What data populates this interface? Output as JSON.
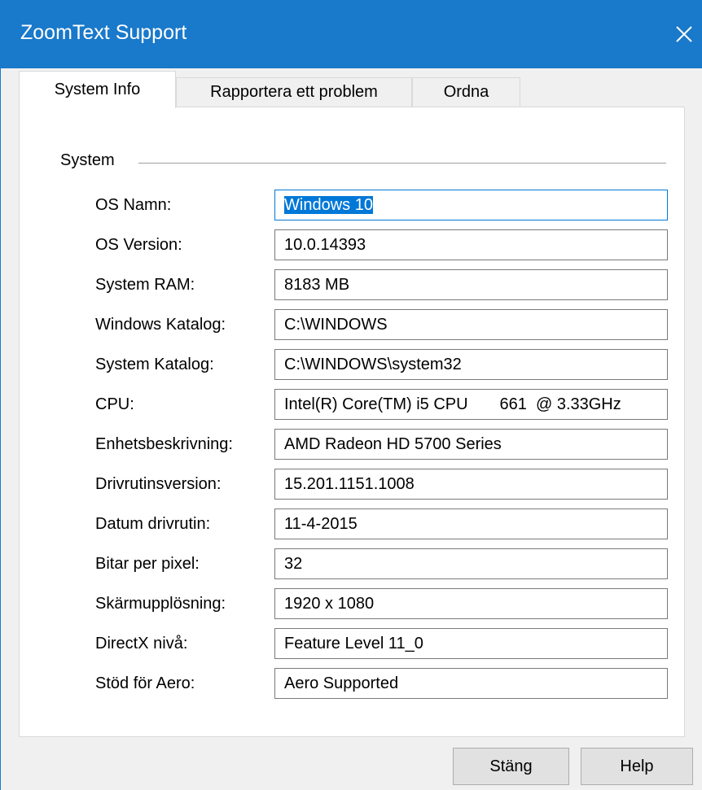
{
  "window": {
    "title": "ZoomText Support",
    "close_label": "×"
  },
  "tabs": [
    {
      "label": "System Info",
      "active": true
    },
    {
      "label": "Rapportera ett problem",
      "active": false
    },
    {
      "label": "Ordna",
      "active": false
    }
  ],
  "system_group": {
    "label": "System",
    "rows": [
      {
        "label": "OS Namn:",
        "value": "Windows 10",
        "focused": true
      },
      {
        "label": "OS Version:",
        "value": "10.0.14393"
      },
      {
        "label": "System RAM:",
        "value": "8183 MB"
      },
      {
        "label": "Windows Katalog:",
        "value": "C:\\WINDOWS"
      },
      {
        "label": "System Katalog:",
        "value": "C:\\WINDOWS\\system32"
      },
      {
        "label": "CPU:",
        "value": "Intel(R) Core(TM) i5 CPU       661  @ 3.33GHz"
      },
      {
        "label": "Enhetsbeskrivning:",
        "value": "AMD Radeon HD 5700 Series"
      },
      {
        "label": "Drivrutinsversion:",
        "value": "15.201.1151.1008"
      },
      {
        "label": "Datum drivrutin:",
        "value": "11-4-2015"
      },
      {
        "label": "Bitar per pixel:",
        "value": "32"
      },
      {
        "label": "Skärmupplösning:",
        "value": "1920 x 1080"
      },
      {
        "label": "DirectX nivå:",
        "value": "Feature Level 11_0"
      },
      {
        "label": "Stöd för Aero:",
        "value": "Aero Supported"
      }
    ]
  },
  "buttons": {
    "close": "Stäng",
    "help": "Help"
  },
  "colors": {
    "titlebar": "#1979ca",
    "selection": "#0078d7",
    "dialog_bg": "#f0f0f0"
  }
}
